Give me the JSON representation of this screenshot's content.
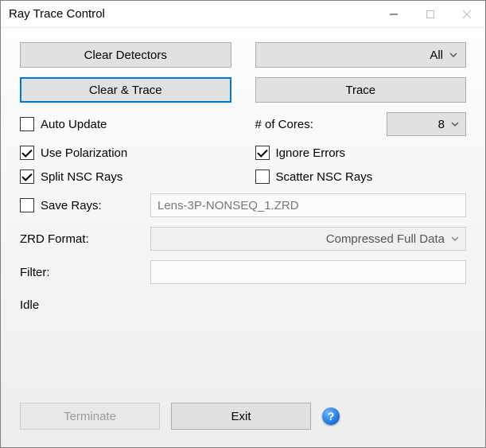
{
  "window": {
    "title": "Ray Trace Control"
  },
  "buttons": {
    "clear_detectors": "Clear Detectors",
    "clear_and_trace": "Clear & Trace",
    "all_dropdown": "All",
    "trace": "Trace"
  },
  "checks": {
    "auto_update": {
      "label": "Auto Update",
      "checked": false
    },
    "use_polarization": {
      "label": "Use Polarization",
      "checked": true
    },
    "split_nsc": {
      "label": "Split NSC Rays",
      "checked": true
    },
    "ignore_errors": {
      "label": "Ignore Errors",
      "checked": true
    },
    "scatter_nsc": {
      "label": "Scatter NSC Rays",
      "checked": false
    },
    "save_rays": {
      "label": "Save Rays:",
      "checked": false
    }
  },
  "cores": {
    "label": "# of Cores:",
    "value": "8"
  },
  "save_rays_file": "Lens-3P-NONSEQ_1.ZRD",
  "zrd_format": {
    "label": "ZRD Format:",
    "value": "Compressed Full Data"
  },
  "filter": {
    "label": "Filter:",
    "value": ""
  },
  "status": "Idle",
  "footer": {
    "terminate": "Terminate",
    "exit": "Exit"
  }
}
